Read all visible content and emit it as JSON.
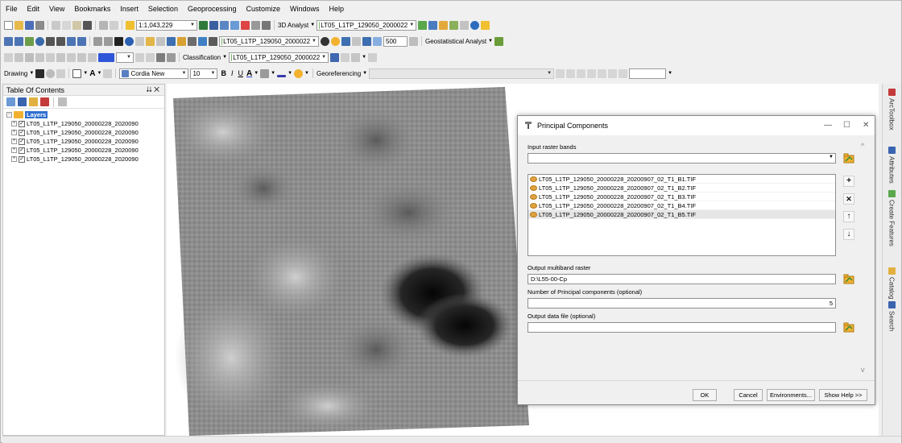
{
  "menu": [
    "File",
    "Edit",
    "View",
    "Bookmarks",
    "Insert",
    "Selection",
    "Geoprocessing",
    "Customize",
    "Windows",
    "Help"
  ],
  "toolbar": {
    "scale": "1:1,043,229",
    "analyst_3d": "3D Analyst",
    "layer_combo_1": "LT05_L1TP_129050_2000022",
    "layer_combo_2": "LT05_L1TP_129050_2000022",
    "layer_combo_3": "LT05_L1TP_129050_2000022",
    "layer_combo_4": "LT05_L1TP_129050_2000022",
    "offset_value": "500",
    "geostatistical": "Geostatistical Analyst",
    "classification": "Classification",
    "drawing": "Drawing",
    "font_name": "Cordia New",
    "font_size": "10",
    "bold": "B",
    "italic": "I",
    "underline": "U",
    "text_a": "A",
    "georeferencing": "Georeferencing"
  },
  "toc": {
    "title": "Table Of Contents",
    "pin": "⮇ ✕",
    "layers_label": "Layers",
    "layers": [
      "LT05_L1TP_129050_20000228_2020090",
      "LT05_L1TP_129050_20000228_2020090",
      "LT05_L1TP_129050_20000228_2020090",
      "LT05_L1TP_129050_20000228_2020090",
      "LT05_L1TP_129050_20000228_2020090"
    ]
  },
  "right_panel": [
    "ArcToolbox",
    "Attributes",
    "Create Features",
    "Catalog",
    "Search"
  ],
  "dialog": {
    "title": "Principal Components",
    "minimize": "—",
    "maximize": "☐",
    "close": "✕",
    "input_label": "Input raster bands",
    "input_value": "",
    "bands": [
      "LT05_L1TP_129050_20000228_20200907_02_T1_B1.TIF",
      "LT05_L1TP_129050_20000228_20200907_02_T1_B2.TIF",
      "LT05_L1TP_129050_20000228_20200907_02_T1_B3.TIF",
      "LT05_L1TP_129050_20000228_20200907_02_T1_B4.TIF",
      "LT05_L1TP_129050_20000228_20200907_02_T1_B5.TIF"
    ],
    "add_btn": "+",
    "remove_btn": "✕",
    "up_btn": "↑",
    "down_btn": "↓",
    "output_label": "Output multiband raster",
    "output_value": "D:\\L55-00-Cp",
    "num_label": "Number of Principal components (optional)",
    "num_value": "5",
    "datafile_label": "Output data file (optional)",
    "datafile_value": "",
    "ok": "OK",
    "cancel": "Cancel",
    "environments": "Environments...",
    "show_help": "Show Help >>"
  },
  "colors": {
    "accent": "#f2b230",
    "selection": "#e6e6e6"
  }
}
